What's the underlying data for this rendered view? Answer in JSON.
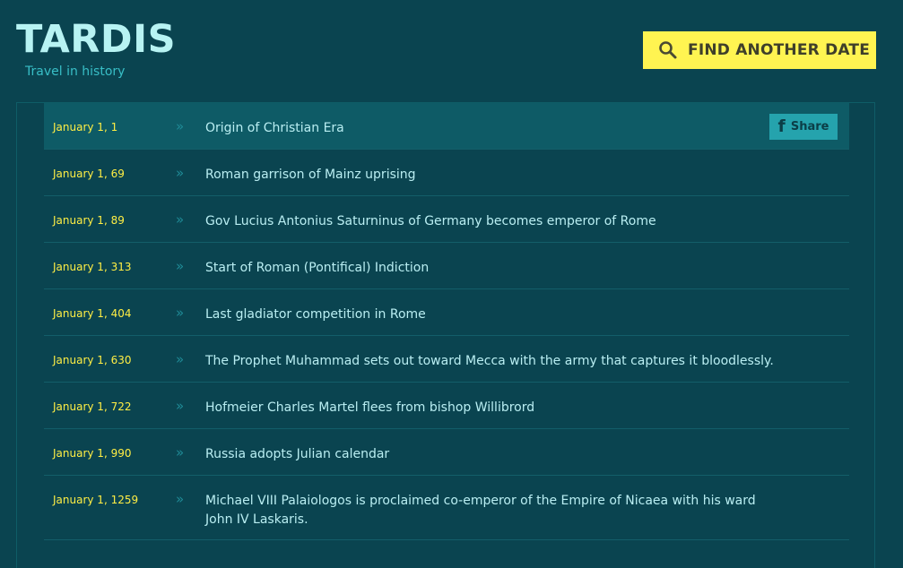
{
  "header": {
    "logo": "TARDIS",
    "tagline": "Travel in history",
    "find_button_label": "FIND ANOTHER DATE",
    "find_button_icon": "search-icon"
  },
  "colors": {
    "background": "#0a4450",
    "active_row": "#0e5b66",
    "date_text": "#ffee44",
    "event_text": "#b9eef2",
    "button_yellow": "#fff451",
    "share_button": "#25a3ad"
  },
  "share": {
    "label": "Share",
    "icon": "facebook-icon"
  },
  "events": [
    {
      "date": "January 1, 1",
      "text": "Origin of Christian Era"
    },
    {
      "date": "January 1, 69",
      "text": "Roman garrison of Mainz uprising"
    },
    {
      "date": "January 1, 89",
      "text": "Gov Lucius Antonius Saturninus of Germany becomes emperor of Rome"
    },
    {
      "date": "January 1, 313",
      "text": "Start of Roman (Pontifical) Indiction"
    },
    {
      "date": "January 1, 404",
      "text": "Last gladiator competition in Rome"
    },
    {
      "date": "January 1, 630",
      "text": "The Prophet Muhammad sets out toward Mecca with the army that captures it bloodlessly."
    },
    {
      "date": "January 1, 722",
      "text": "Hofmeier Charles Martel flees from bishop Willibrord"
    },
    {
      "date": "January 1, 990",
      "text": "Russia adopts Julian calendar"
    },
    {
      "date": "January 1, 1259",
      "text": "Michael VIII Palaiologos is proclaimed co-emperor of the Empire of Nicaea with his ward John IV Laskaris."
    }
  ]
}
